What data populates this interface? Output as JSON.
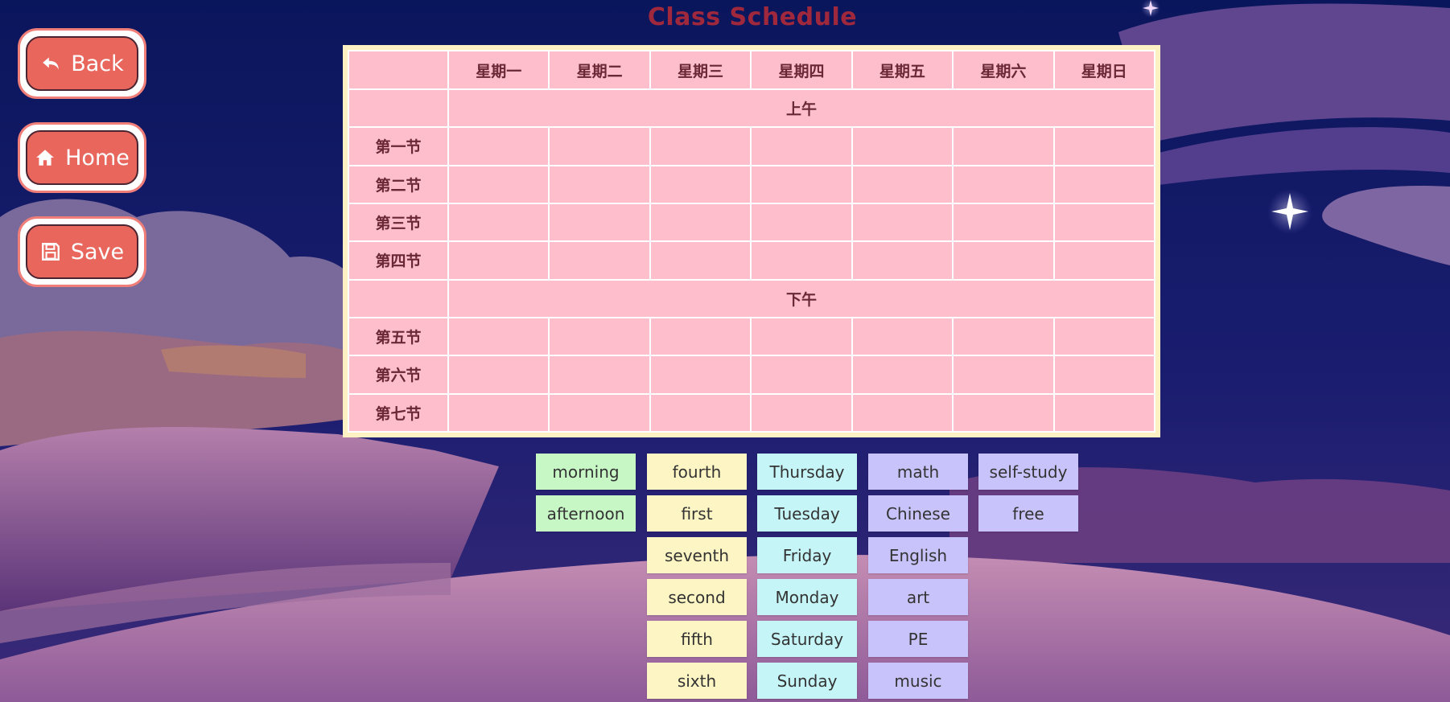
{
  "title": "Class Schedule",
  "nav": {
    "back_label": "Back",
    "home_label": "Home",
    "save_label": "Save"
  },
  "schedule": {
    "days": [
      "星期一",
      "星期二",
      "星期三",
      "星期四",
      "星期五",
      "星期六",
      "星期日"
    ],
    "morning_label": "上午",
    "afternoon_label": "下午",
    "morning_periods": [
      "第一节",
      "第二节",
      "第三节",
      "第四节"
    ],
    "afternoon_periods": [
      "第五节",
      "第六节",
      "第七节"
    ]
  },
  "word_bank": {
    "time_of_day": [
      "morning",
      "afternoon"
    ],
    "ordinals": [
      "fourth",
      "first",
      "seventh",
      "second",
      "fifth",
      "sixth"
    ],
    "weekdays": [
      "Thursday",
      "Tuesday",
      "Friday",
      "Monday",
      "Saturday",
      "Sunday"
    ],
    "subjects": [
      "math",
      "Chinese",
      "English",
      "art",
      "PE",
      "music"
    ],
    "other": [
      "self-study",
      "free"
    ]
  },
  "colors": {
    "title": "#a0283c",
    "button": "#e8665c",
    "table_bg": "#ffbecb",
    "table_frame": "#fdf0c2",
    "chip_green": "#c8f7c6",
    "chip_yellow": "#fdf5c3",
    "chip_cyan": "#c6f5f7",
    "chip_lavender": "#c8c4fb"
  },
  "icons": {
    "back": "undo-arrow-icon",
    "home": "home-icon",
    "save": "floppy-disk-icon"
  }
}
